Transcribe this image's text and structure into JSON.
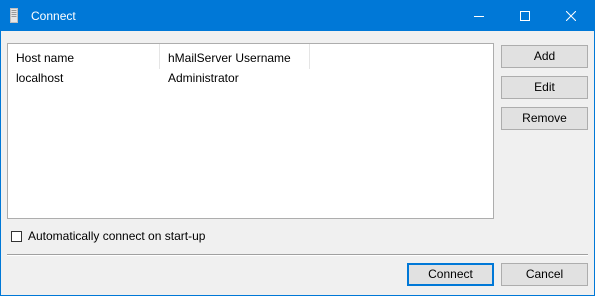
{
  "window": {
    "title": "Connect",
    "accent_color": "#0078d7"
  },
  "servers_list": {
    "columns": [
      "Host name",
      "hMailServer Username"
    ],
    "rows": [
      [
        "localhost",
        "Administrator"
      ]
    ]
  },
  "side_buttons": {
    "add": "Add",
    "edit": "Edit",
    "remove": "Remove"
  },
  "auto_connect": {
    "label": "Automatically connect on start-up",
    "checked": false
  },
  "footer": {
    "connect": "Connect",
    "cancel": "Cancel"
  }
}
